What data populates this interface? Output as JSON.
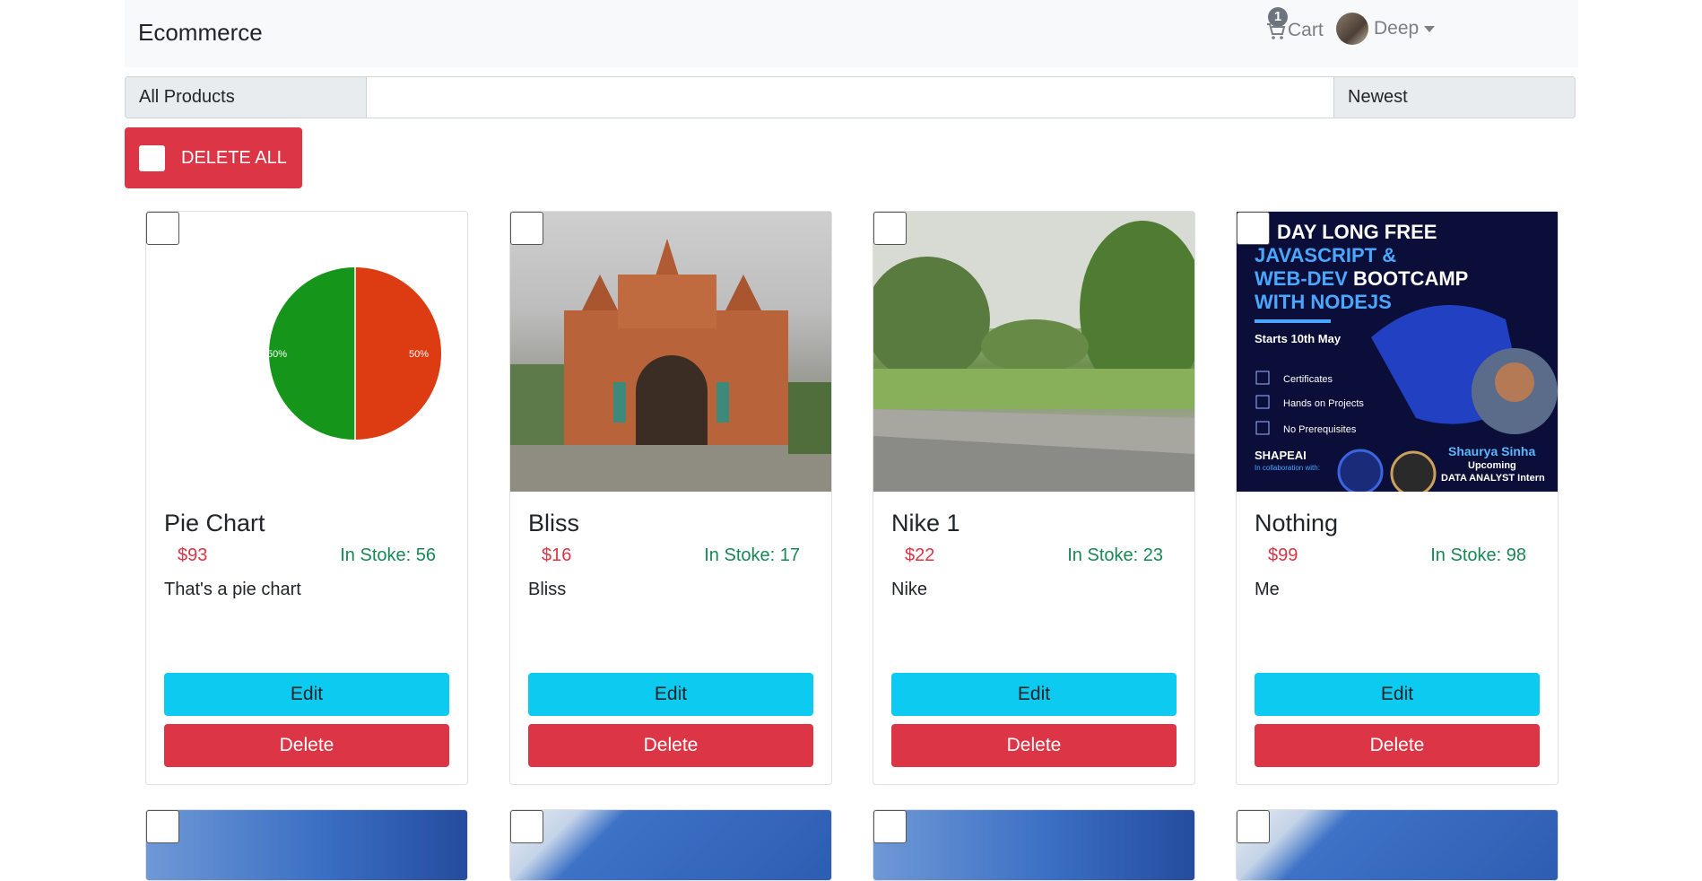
{
  "nav": {
    "brand": "Ecommerce",
    "cart_label": "Cart",
    "cart_count": "1",
    "user_name": "Deep"
  },
  "filters": {
    "category": "All Products",
    "search_value": "",
    "sort": "Newest"
  },
  "bulk": {
    "delete_all_label": "DELETE ALL"
  },
  "products": [
    {
      "title": "Pie Chart",
      "price": "$93",
      "stock": "In Stoke: 56",
      "desc": "That's a pie chart",
      "edit": "Edit",
      "delete": "Delete",
      "image_labels": [
        "50%",
        "50%"
      ]
    },
    {
      "title": "Bliss",
      "price": "$16",
      "stock": "In Stoke: 17",
      "desc": "Bliss",
      "edit": "Edit",
      "delete": "Delete"
    },
    {
      "title": "Nike 1",
      "price": "$22",
      "stock": "In Stoke: 23",
      "desc": "Nike",
      "edit": "Edit",
      "delete": "Delete"
    },
    {
      "title": "Nothing",
      "price": "$99",
      "stock": "In Stoke: 98",
      "desc": "Me",
      "edit": "Edit",
      "delete": "Delete",
      "image_text": {
        "l1": "DAY LONG FREE",
        "l2a": "JAVASCRIPT &",
        "l3a": "WEB-DEV",
        "l3b": " BOOTCAMP",
        "l4": "WITH NODEJS",
        "date": "Starts 10th May",
        "b1": "Certificates",
        "b2": "Hands on Projects",
        "b3": "No Prerequisites",
        "brand": "SHAPEAI",
        "collab": "In collaboration with:",
        "name": "Shaurya Sinha",
        "role1": "Upcoming",
        "role2": "DATA ANALYST Intern"
      }
    }
  ],
  "colors": {
    "primary_danger": "#dc3545",
    "info": "#0dcaf0",
    "success": "#198754"
  }
}
